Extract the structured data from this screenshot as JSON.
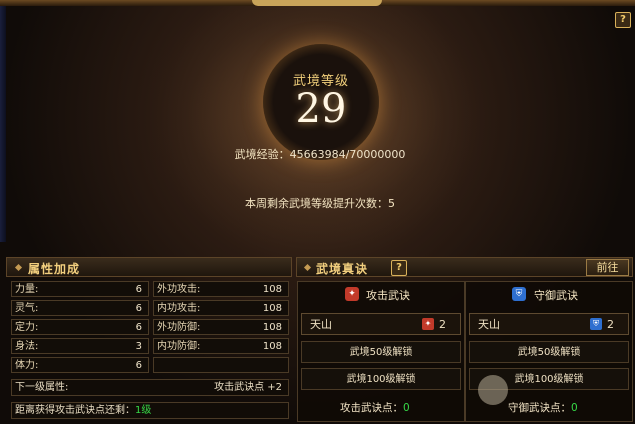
{
  "colors": {
    "accent_gold": "#f2cf7e",
    "green_value": "#36d847",
    "attack_icon": "#c23a2a",
    "defense_icon": "#2e6fd0"
  },
  "top": {
    "help_glyph": "?",
    "level_title": "武境等级",
    "level_value": "29",
    "exp_label": "武境经验：",
    "exp_value": "45663984/70000000",
    "weekly_label": "本周剩余武境等级提升次数：5"
  },
  "attributes": {
    "title": "属性加成",
    "items": [
      {
        "label": "力量:",
        "value": "6"
      },
      {
        "label": "外功攻击:",
        "value": "108"
      },
      {
        "label": "灵气:",
        "value": "6"
      },
      {
        "label": "内功攻击:",
        "value": "108"
      },
      {
        "label": "定力:",
        "value": "6"
      },
      {
        "label": "外功防御:",
        "value": "108"
      },
      {
        "label": "身法:",
        "value": "3"
      },
      {
        "label": "内功防御:",
        "value": "108"
      },
      {
        "label": "体力:",
        "value": "6"
      },
      {
        "label": "",
        "value": ""
      }
    ],
    "next_label": "下一级属性:",
    "next_value": "攻击武诀点 +2",
    "distance_label": "距离获得攻击武诀点还剩：",
    "distance_value": "1级"
  },
  "skills": {
    "title": "武境真诀",
    "help_glyph": "?",
    "goto_label": "前往",
    "attack": {
      "title": "攻击武诀",
      "icon": "attack-icon",
      "slot_name": "天山",
      "slot_count": "2",
      "unlock50": "武境50级解锁",
      "unlock100": "武境100级解锁",
      "points_label": "攻击武诀点：",
      "points_value": "0"
    },
    "defense": {
      "title": "守御武诀",
      "icon": "defense-icon",
      "slot_name": "天山",
      "slot_count": "2",
      "unlock50": "武境50级解锁",
      "unlock100": "武境100级解锁",
      "points_label": "守御武诀点：",
      "points_value": "0"
    }
  }
}
